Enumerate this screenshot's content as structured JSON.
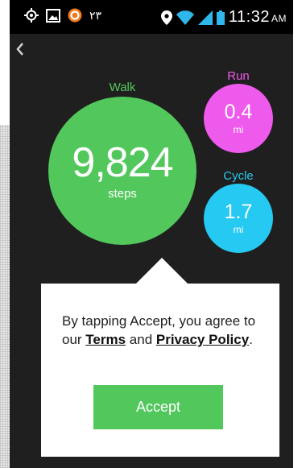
{
  "status_bar": {
    "notification_text": "۲۳",
    "time": "11:32",
    "ampm": "AM"
  },
  "activities": {
    "walk": {
      "label": "Walk",
      "value": "9,824",
      "unit": "steps",
      "color": "#52c75c"
    },
    "run": {
      "label": "Run",
      "value": "0.4",
      "unit": "mi",
      "color": "#ee5aec"
    },
    "cycle": {
      "label": "Cycle",
      "value": "1.7",
      "unit": "mi",
      "color": "#25c9f1"
    }
  },
  "dialog": {
    "text_prefix": "By tapping Accept, you agree to our ",
    "terms_link": "Terms",
    "text_and": " and ",
    "privacy_link": "Privacy Policy",
    "text_suffix": ".",
    "accept_label": "Accept"
  },
  "colors": {
    "background": "#1f1f1f",
    "status_bar": "#000000",
    "accept_button": "#52c75c"
  }
}
